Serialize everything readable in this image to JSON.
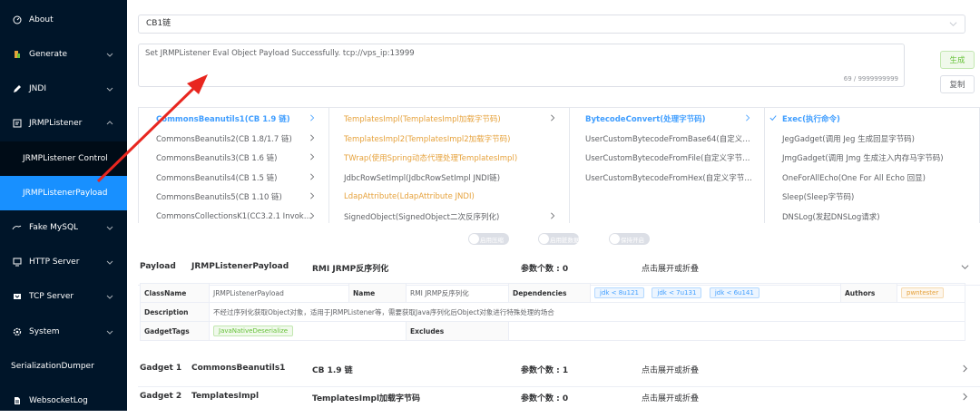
{
  "sidebar": {
    "items": [
      {
        "label": "About",
        "icon": "dashboard-icon",
        "has_arrow": false
      },
      {
        "label": "Generate",
        "icon": "generate-icon",
        "has_arrow": true
      },
      {
        "label": "JNDI",
        "icon": "pen-icon",
        "has_arrow": true
      },
      {
        "label": "JRMPListener",
        "icon": "listener-icon",
        "has_arrow": true,
        "expanded": true
      },
      {
        "label": "JRMPListener Control",
        "sub": true
      },
      {
        "label": "JRMPListenerPayload",
        "sub": true,
        "active": true
      },
      {
        "label": "Fake MySQL",
        "icon": "mysql-icon",
        "has_arrow": true
      },
      {
        "label": "HTTP Server",
        "icon": "server-icon",
        "has_arrow": true
      },
      {
        "label": "TCP Server",
        "icon": "tcp-icon",
        "has_arrow": true
      },
      {
        "label": "System",
        "icon": "gear-icon",
        "has_arrow": true
      },
      {
        "label": "SerializationDumper",
        "noicon": true
      },
      {
        "label": "WebsocketLog",
        "icon": "document-icon"
      }
    ]
  },
  "select": {
    "value": "CB1链"
  },
  "output": {
    "text": "Set JRMPListener Eval Object Payload Successfully. tcp://vps_ip:13999",
    "counter": "69 / 9999999999"
  },
  "buttons": {
    "generate": "生成",
    "copy": "复制"
  },
  "cascader": {
    "col1": [
      "CommonsBeanutils1(CB 1.9 链)",
      "CommonsBeanutils2(CB 1.8/1.7 链)",
      "CommonsBeanutils3(CB 1.6 链)",
      "CommonsBeanutils4(CB 1.5 链)",
      "CommonsBeanutils5(CB 1.10 链)",
      "CommonsCollectionsK1(CC3.2.1 Invok…"
    ],
    "col2": [
      "TemplatesImpl(TemplatesImpl加载字节码)",
      "TemplatesImpl2(TemplatesImpl2加载字节码)",
      "TWrap(使用Spring动态代理处理TemplatesImpl)",
      "JdbcRowSetImpl(JdbcRowSetImpl JNDI链)",
      "LdapAttribute(LdapAttribute JNDI)",
      "SignedObject(SignedObject二次反序列化)"
    ],
    "col3": [
      "BytecodeConvert(处理字节码)",
      "UserCustomBytecodeFromBase64(自定义…",
      "UserCustomBytecodeFromFile(自定义字节…",
      "UserCustomBytecodeFromHex(自定义字节…"
    ],
    "col4": [
      "Exec(执行命令)",
      "JegGadget(调用 Jeg 生成回显字节码)",
      "JmgGadget(调用 Jmg 生成注入内存马字节码)",
      "OneForAllEcho(One For All Echo 回显)",
      "Sleep(Sleep字节码)",
      "DNSLog(发起DNSLog请求)"
    ]
  },
  "switches": [
    "启用压缩",
    "启用脏数据",
    "保持开启"
  ],
  "payload": {
    "label": "Payload",
    "name": "JRMPListenerPayload",
    "desc": "RMI JRMP反序列化",
    "params": "参数个数 : 0",
    "toggle": "点击展开或折叠",
    "table": {
      "classname_k": "ClassName",
      "classname_v": "JRMPListenerPayload",
      "name_k": "Name",
      "name_v": "RMI JRMP反序列化",
      "deps_k": "Dependencies",
      "deps": [
        "jdk < 8u121",
        "jdk < 7u131",
        "jdk < 6u141"
      ],
      "authors_k": "Authors",
      "author": "pwntester",
      "description_k": "Description",
      "description_v": "不经过序列化获取Object对象，适用于JRMPListener等，需要获取Java序列化后Object对象进行特殊处理的场合",
      "tags_k": "GadgetTags",
      "tag": "JavaNativeDeserialize",
      "excludes_k": "Excludes"
    }
  },
  "gadgets": [
    {
      "label": "Gadget 1",
      "name": "CommonsBeanutils1",
      "desc": "CB 1.9 链",
      "params": "参数个数 : 1",
      "toggle": "点击展开或折叠"
    },
    {
      "label": "Gadget 2",
      "name": "TemplatesImpl",
      "desc": "TemplatesImpl加载字节码",
      "params": "参数个数 : 0",
      "toggle": "点击展开或折叠"
    }
  ],
  "colors": {
    "sidebar": "#001529",
    "active": "#1890ff",
    "accent": "#409eff",
    "orange": "#e6a23c",
    "arrow": "#e8261f"
  }
}
